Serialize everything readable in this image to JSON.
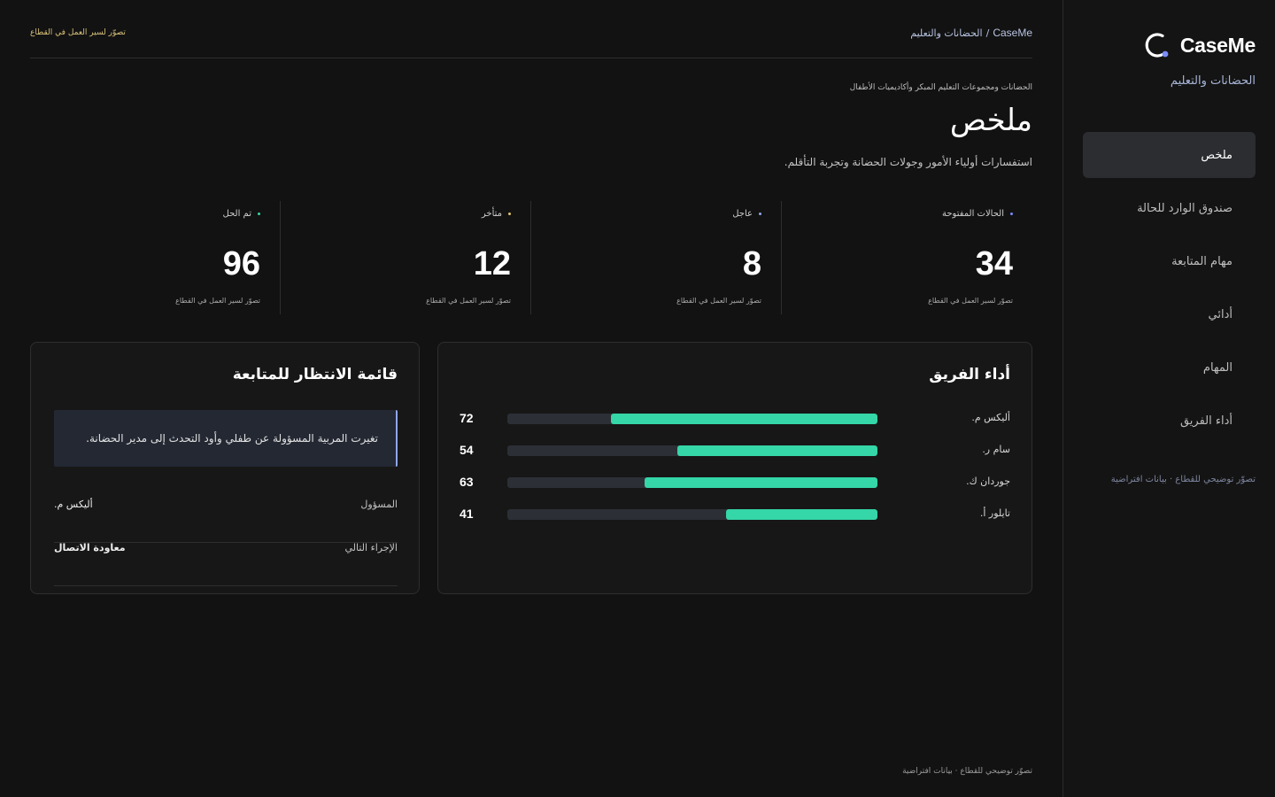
{
  "brand": {
    "name": "CaseMe",
    "subtitle": "الحضانات والتعليم",
    "accent": "#7b8cff"
  },
  "nav": {
    "items": [
      {
        "label": "ملخص",
        "active": true
      },
      {
        "label": "صندوق الوارد للحالة"
      },
      {
        "label": "مهام المتابعة"
      },
      {
        "label": "أدائي"
      },
      {
        "label": "المهام"
      },
      {
        "label": "أداء الفريق"
      }
    ],
    "footer": "تصوّر توضيحي للقطاع · بيانات افتراضية"
  },
  "topbar": {
    "breadcrumb_brand": "CaseMe",
    "breadcrumb_sep": "/",
    "breadcrumb_section": "الحضانات والتعليم",
    "note": "تصوّر لسير العمل في القطاع"
  },
  "header": {
    "eyebrow": "الحضانات ومجموعات التعليم المبكر وأكاديميات الأطفال",
    "title": "ملخص",
    "description": "استفسارات أولياء الأمور وجولات الحضانة وتجربة التأقلم."
  },
  "stats": [
    {
      "label": "الحالات المفتوحة",
      "value": "34",
      "note": "تصوّر لسير العمل في القطاع",
      "dot_color": "#7b8cff"
    },
    {
      "label": "عاجل",
      "value": "8",
      "note": "تصوّر لسير العمل في القطاع",
      "dot_color": "#8ea7e8"
    },
    {
      "label": "متأخر",
      "value": "12",
      "note": "تصوّر لسير العمل في القطاع",
      "dot_color": "#e0c36a"
    },
    {
      "label": "تم الحل",
      "value": "96",
      "note": "تصوّر لسير العمل في القطاع",
      "dot_color": "#35d6a7"
    }
  ],
  "team": {
    "title": "أداء الفريق",
    "bar_color": "#35d6a7",
    "track_color": "#2c2f36",
    "members": [
      {
        "name": "أليكس م.",
        "value": 72
      },
      {
        "name": "سام ر.",
        "value": 54
      },
      {
        "name": "جوردان ك.",
        "value": 63
      },
      {
        "name": "تايلور أ.",
        "value": 41
      }
    ]
  },
  "queue": {
    "title": "قائمة الانتظار للمتابعة",
    "message": "تغيرت المربية المسؤولة عن طفلي وأود التحدث إلى مدير الحضانة.",
    "owner_label": "المسؤول",
    "owner_value": "أليكس م.",
    "next_label": "الإجراء التالي",
    "next_value": "معاودة الاتصال"
  },
  "footer": {
    "note": "تصوّر توضيحي للقطاع · بيانات افتراضية"
  }
}
